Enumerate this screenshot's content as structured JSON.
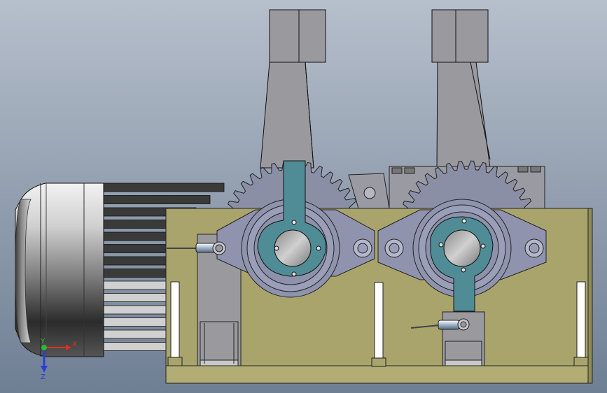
{
  "viewport": {
    "background_top": "#b6bfcc",
    "background_bottom": "#6f7f93"
  },
  "triad": {
    "x_label": "X",
    "y_label": "Y",
    "z_label": "Z",
    "x_color": "#e0301e",
    "y_color": "#2fb82f",
    "z_color": "#2a3fd6"
  },
  "colors": {
    "base_plate": "#a8a46c",
    "gear": "#8a8fa5",
    "housing": "#8f93ad",
    "lever": "#4f8c96",
    "bracket": "#9a9a9e",
    "motor_dark": "#2a2a2a"
  }
}
